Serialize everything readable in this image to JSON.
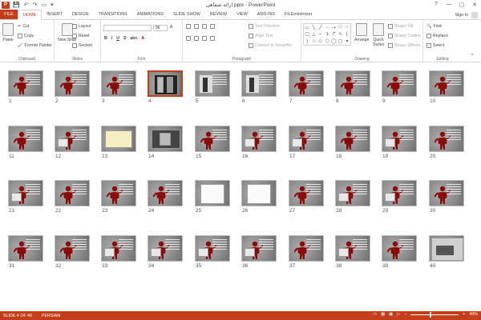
{
  "titlebar": {
    "app_icon": "P",
    "title": "ارائه شفاهی.pptx - PowerPoint",
    "qat": [
      "save-icon",
      "undo-icon",
      "redo-icon",
      "start-icon",
      "customize-icon"
    ],
    "window_controls": [
      "?",
      "—",
      "▢",
      "✕"
    ]
  },
  "tabs": {
    "file": "FILE",
    "items": [
      "HOME",
      "INSERT",
      "DESIGN",
      "TRANSITIONS",
      "ANIMATIONS",
      "SLIDE SHOW",
      "REVIEW",
      "VIEW",
      "ADD-INS",
      "FILEminimizer"
    ],
    "active": "HOME",
    "signin": "Sign in"
  },
  "ribbon": {
    "clipboard": {
      "label": "Clipboard",
      "paste": "Paste",
      "cut": "Cut",
      "copy": "Copy",
      "format_painter": "Format Painter"
    },
    "slides": {
      "label": "Slides",
      "new_slide": "New Slide",
      "layout": "Layout",
      "reset": "Reset",
      "section": "Section"
    },
    "font": {
      "label": "Font",
      "size": "96"
    },
    "paragraph": {
      "label": "Paragraph",
      "text_direction": "Text Direction",
      "align_text": "Align Text",
      "convert": "Convert to SmartArt"
    },
    "drawing": {
      "label": "Drawing",
      "arrange": "Arrange",
      "quick_styles": "Quick Styles",
      "shape_fill": "Shape Fill",
      "shape_outline": "Shape Outline",
      "shape_effects": "Shape Effects"
    },
    "editing": {
      "label": "Editing",
      "find": "Find",
      "replace": "Replace",
      "select": "Select"
    }
  },
  "slides": {
    "numbers": [
      "1",
      "2",
      "3",
      "4",
      "5",
      "6",
      "7",
      "8",
      "9",
      "10",
      "11",
      "12",
      "13",
      "14",
      "15",
      "16",
      "17",
      "18",
      "19",
      "20",
      "21",
      "22",
      "23",
      "24",
      "25",
      "26",
      "27",
      "28",
      "29",
      "30",
      "31",
      "32",
      "33",
      "34",
      "35",
      "36",
      "37",
      "38",
      "39",
      "40"
    ],
    "selected": 4
  },
  "statusbar": {
    "slide_info": "SLIDE 4 OF 40",
    "language": "PERSIAN",
    "zoom": "40%",
    "zoom_level": 0.4
  }
}
